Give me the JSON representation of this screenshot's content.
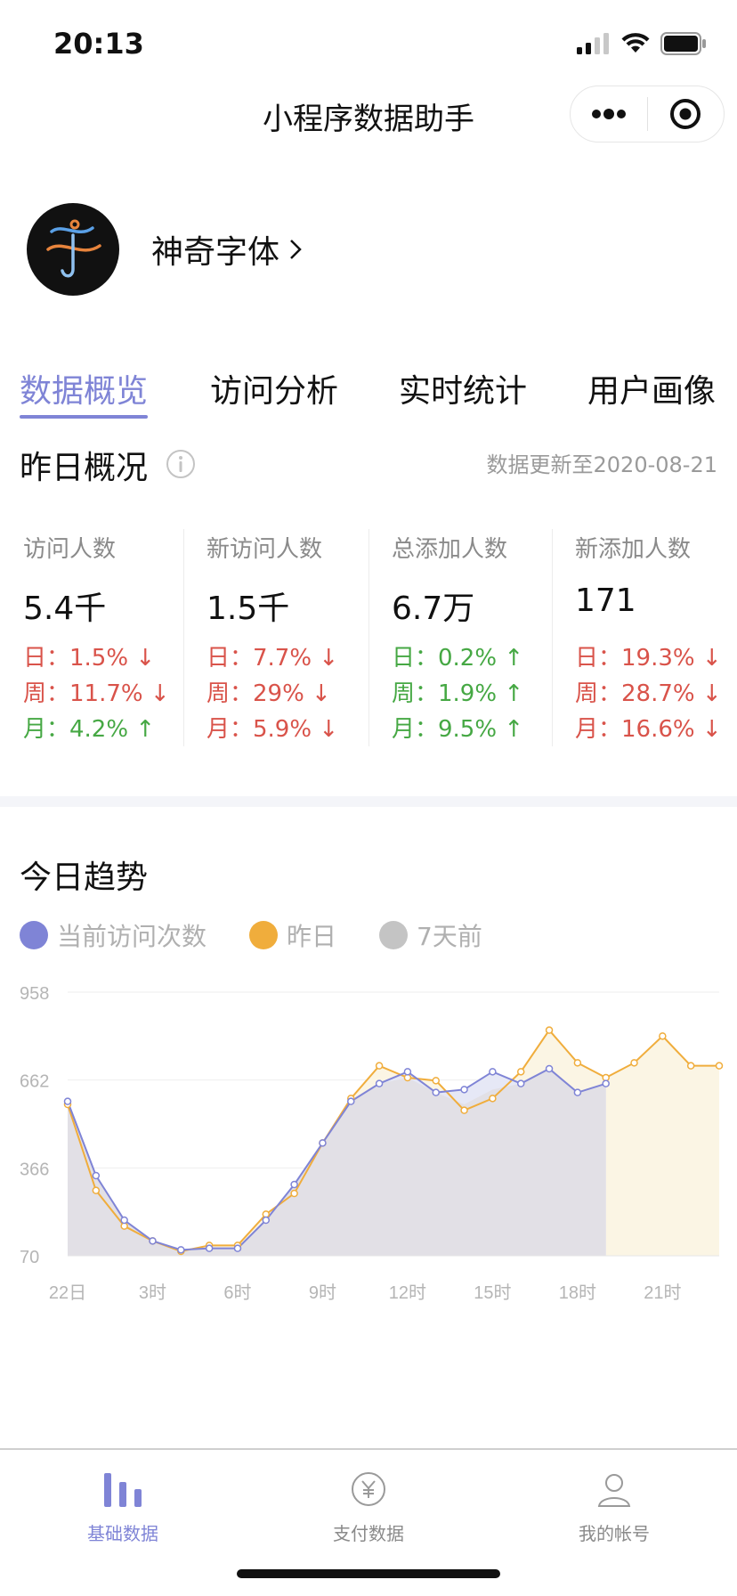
{
  "status_bar": {
    "time": "20:13"
  },
  "navbar": {
    "title": "小程序数据助手"
  },
  "app": {
    "name": "神奇字体"
  },
  "tabs": [
    {
      "label": "数据概览",
      "active": true
    },
    {
      "label": "访问分析",
      "active": false
    },
    {
      "label": "实时统计",
      "active": false
    },
    {
      "label": "用户画像",
      "active": false
    }
  ],
  "overview": {
    "title": "昨日概况",
    "updated": "数据更新至2020-08-21",
    "stats": [
      {
        "label": "访问人数",
        "value": "5.4千",
        "lines": [
          {
            "text": "日：1.5%",
            "arrow": "down"
          },
          {
            "text": "周：11.7%",
            "arrow": "down"
          },
          {
            "text": "月：4.2%",
            "arrow": "up"
          }
        ]
      },
      {
        "label": "新访问人数",
        "value": "1.5千",
        "lines": [
          {
            "text": "日：7.7%",
            "arrow": "down"
          },
          {
            "text": "周：29%",
            "arrow": "down"
          },
          {
            "text": "月：5.9%",
            "arrow": "down"
          }
        ]
      },
      {
        "label": "总添加人数",
        "value": "6.7万",
        "lines": [
          {
            "text": "日：0.2%",
            "arrow": "up"
          },
          {
            "text": "周：1.9%",
            "arrow": "up"
          },
          {
            "text": "月：9.5%",
            "arrow": "up"
          }
        ]
      },
      {
        "label": "新添加人数",
        "value": "171",
        "lines": [
          {
            "text": "日：19.3%",
            "arrow": "down"
          },
          {
            "text": "周：28.7%",
            "arrow": "down"
          },
          {
            "text": "月：16.6%",
            "arrow": "down"
          }
        ]
      }
    ],
    "colors": {
      "down": "#d9534a",
      "up": "#46a844"
    }
  },
  "trend": {
    "title": "今日趋势",
    "legend": [
      {
        "name": "当前访问次数",
        "color": "#7f84d6"
      },
      {
        "name": "昨日",
        "color": "#f0ad3c"
      },
      {
        "name": "7天前",
        "color": "#c4c4c4"
      }
    ]
  },
  "chart_data": {
    "type": "line",
    "y_ticks": [
      70,
      366,
      662,
      958
    ],
    "ylim": [
      70,
      958
    ],
    "x_tick_labels": [
      "22日",
      "3时",
      "6时",
      "9时",
      "12时",
      "15时",
      "18时",
      "21时"
    ],
    "x_ticks_at": [
      0,
      3,
      6,
      9,
      12,
      15,
      18,
      21
    ],
    "x_range": [
      0,
      23
    ],
    "series": [
      {
        "name": "当前访问次数",
        "color": "#7f84d6",
        "x": [
          0,
          1,
          2,
          3,
          4,
          5,
          6,
          7,
          8,
          9,
          10,
          11,
          12,
          13,
          14,
          15,
          16,
          17,
          18,
          19
        ],
        "values": [
          590,
          340,
          190,
          120,
          90,
          95,
          95,
          190,
          310,
          450,
          590,
          650,
          690,
          620,
          630,
          690,
          650,
          700,
          620,
          650
        ]
      },
      {
        "name": "昨日",
        "color": "#f0ad3c",
        "x": [
          0,
          1,
          2,
          3,
          4,
          5,
          6,
          7,
          8,
          9,
          10,
          11,
          12,
          13,
          14,
          15,
          16,
          17,
          18,
          19,
          20,
          21,
          22,
          23
        ],
        "values": [
          580,
          290,
          170,
          120,
          85,
          105,
          105,
          210,
          280,
          450,
          600,
          710,
          670,
          660,
          560,
          600,
          690,
          830,
          720,
          670,
          720,
          810,
          710,
          710
        ]
      },
      {
        "name": "7天前",
        "color": "#c4c4c4",
        "x": [
          0,
          1,
          2,
          3,
          4,
          5,
          6,
          7,
          8,
          9,
          10,
          11,
          12,
          13,
          14,
          15,
          16,
          17,
          18,
          19
        ],
        "values": [
          590,
          340,
          190,
          120,
          90,
          95,
          95,
          190,
          310,
          450,
          590,
          650,
          670,
          620,
          580,
          630,
          650,
          700,
          620,
          650
        ]
      }
    ]
  },
  "tabbar": [
    {
      "label": "基础数据",
      "icon": "bar-chart-icon",
      "active": true
    },
    {
      "label": "支付数据",
      "icon": "yen-coin-icon",
      "active": false
    },
    {
      "label": "我的帐号",
      "icon": "user-icon",
      "active": false
    }
  ]
}
